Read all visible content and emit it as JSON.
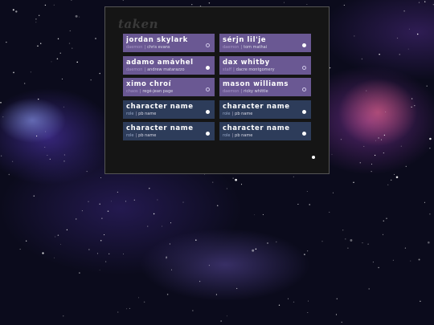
{
  "panel": {
    "title": "taken"
  },
  "cards": [
    {
      "name": "jordan skylark",
      "role": "daemon",
      "pb": "chris evans",
      "status": "hollow",
      "theme": "purple"
    },
    {
      "name": "sérjn lil'je",
      "role": "daemon",
      "pb": "tom mathai",
      "status": "filled",
      "theme": "purple"
    },
    {
      "name": "adamo amávhel",
      "role": "daemon",
      "pb": "andrew matarazzo",
      "status": "filled",
      "theme": "purple"
    },
    {
      "name": "dax whitby",
      "role": "staff",
      "pb": "dacre montgomery",
      "status": "hollow",
      "theme": "purple"
    },
    {
      "name": "ximo chroí",
      "role": "chaos",
      "pb": "regé-jean page",
      "status": "hollow",
      "theme": "purple"
    },
    {
      "name": "mason williams",
      "role": "daemon",
      "pb": "ricky whittle",
      "status": "hollow",
      "theme": "purple"
    },
    {
      "name": "character name",
      "role": "role",
      "pb": "pb name",
      "status": "filled",
      "theme": "blue"
    },
    {
      "name": "character name",
      "role": "role",
      "pb": "pb name",
      "status": "filled",
      "theme": "blue"
    },
    {
      "name": "character name",
      "role": "role",
      "pb": "pb name",
      "status": "filled",
      "theme": "blue"
    },
    {
      "name": "character name",
      "role": "role",
      "pb": "pb name",
      "status": "filled",
      "theme": "blue"
    }
  ],
  "separator": "|",
  "colors": {
    "card_purple": "#6a5893",
    "card_blue": "#2d3c5a",
    "panel_bg": "#151515"
  }
}
